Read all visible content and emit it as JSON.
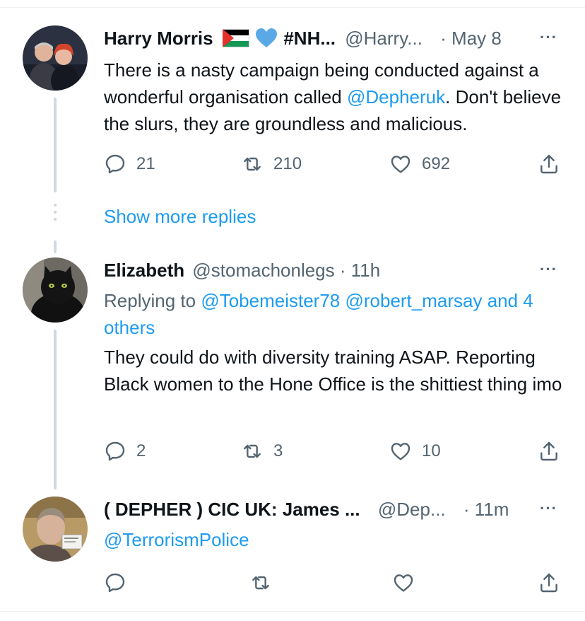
{
  "tweets": [
    {
      "name": "Harry Morris",
      "name_suffix": "#NH...",
      "handle": "@Harry...",
      "time": "· May 8",
      "text_1": "There is a nasty campaign being conducted against a wonderful organisation called ",
      "mention": "@Depheruk",
      "text_2": ". Don't believe the slurs, they are groundless and malicious.",
      "replies": "21",
      "retweets": "210",
      "likes": "692"
    },
    {
      "name": "Elizabeth",
      "handle": "@stomachonlegs · 11h",
      "replying_prefix": "Replying to ",
      "replying_to": "@Tobemeister78 @robert_marsay and 4 others",
      "text": "They could do with diversity training ASAP. Reporting Black women to the Hone Office is the shittiest thing imo",
      "replies": "2",
      "retweets": "3",
      "likes": "10"
    },
    {
      "name": "( DEPHER ) CIC UK: James ...",
      "handle": "@Dep...",
      "time": "· 11m",
      "text": "@TerrorismPolice"
    }
  ],
  "show_more_replies": "Show more replies",
  "more_icon": "···",
  "colors": {
    "accent": "#1d9bf0",
    "muted": "#536471",
    "text": "#0f1419",
    "thread_line": "#cfd9de"
  }
}
